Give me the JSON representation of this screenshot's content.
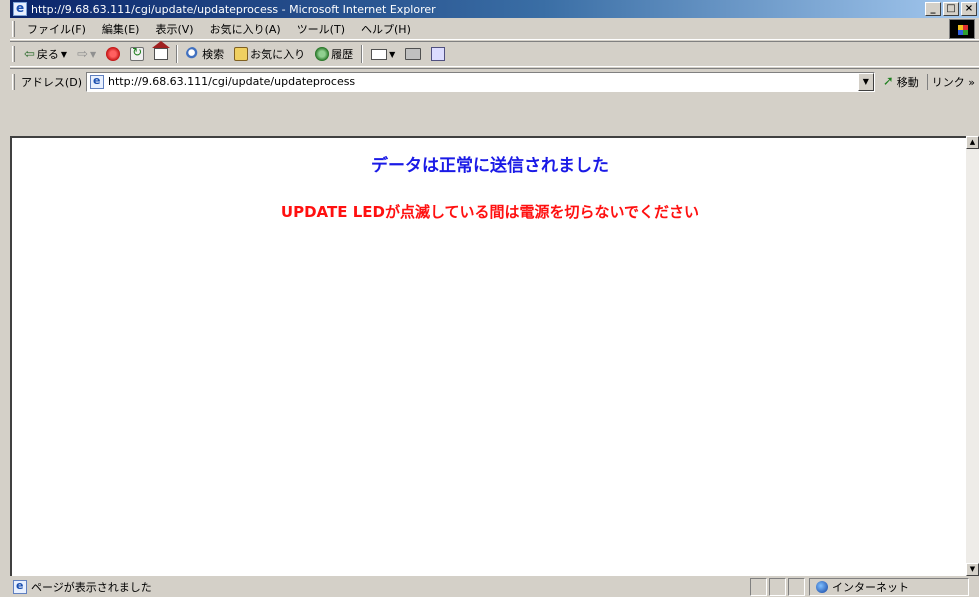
{
  "window": {
    "title": "http://9.68.63.111/cgi/update/updateprocess - Microsoft Internet Explorer",
    "minimize": "_",
    "maximize": "□",
    "close": "×"
  },
  "menu": [
    "ファイル(F)",
    "編集(E)",
    "表示(V)",
    "お気に入り(A)",
    "ツール(T)",
    "ヘルプ(H)"
  ],
  "toolbar": {
    "back_label": "戻る",
    "search_label": "検索",
    "favorites_label": "お気に入り",
    "history_label": "履歴"
  },
  "address": {
    "label": "アドレス(D)",
    "url": "http://9.68.63.111/cgi/update/updateprocess",
    "go_label": "移動",
    "links_label": "リンク »"
  },
  "content": {
    "message_main": "データは正常に送信されました",
    "message_warning": "UPDATE LEDが点滅している間は電源を切らないでください",
    "colors": {
      "main": "#1a1ae6",
      "warning": "#ff1010"
    }
  },
  "status": {
    "text": "ページが表示されました",
    "zone": "インターネット"
  }
}
